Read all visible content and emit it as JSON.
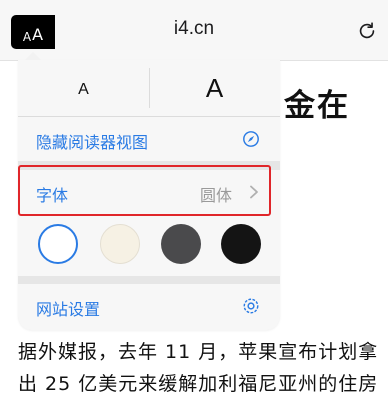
{
  "toolbar": {
    "reader_button": {
      "small": "A",
      "large": "A"
    },
    "url": "i4.cn",
    "reload_icon": "reload-icon"
  },
  "reader_menu": {
    "font_size_small": "A",
    "font_size_large": "A",
    "hide_reader_label": "隐藏阅读器视图",
    "hide_reader_icon": "compass-icon",
    "font_label": "字体",
    "font_value": "圆体",
    "themes": [
      "white",
      "sepia",
      "gray",
      "black"
    ],
    "selected_theme": "white",
    "website_settings_label": "网站设置",
    "website_settings_icon": "gear-icon"
  },
  "article": {
    "title_fragment": "金在",
    "lines": [
      "据外媒报，去年 11 月，苹果宣布计划拿",
      "出 25 亿美元来缓解加利福尼亚州的住房"
    ]
  },
  "colors": {
    "accent": "#2a7be4",
    "highlight": "#e0262a",
    "theme_sepia": "#f6f1e4",
    "theme_gray": "#4a4a4c",
    "theme_black": "#141414"
  }
}
